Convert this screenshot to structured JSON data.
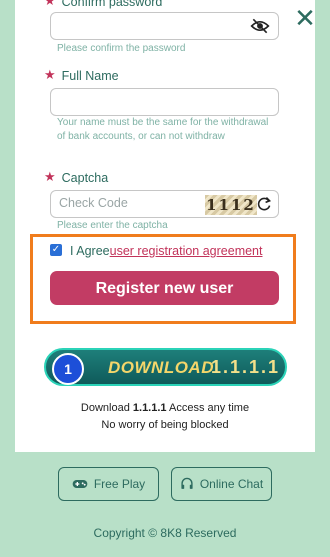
{
  "form": {
    "confirm_password": {
      "label": "Confirm password",
      "hint": "Please confirm the password"
    },
    "full_name": {
      "label": "Full Name",
      "hint": "Your name must be the same for the withdrawal of bank accounts, or can not withdraw"
    },
    "captcha": {
      "label": "Captcha",
      "placeholder": "Check Code",
      "code": "1112",
      "hint": "Please enter the captcha"
    },
    "agreement": {
      "prefix": "I Agree",
      "link": "user registration agreement",
      "checked": true
    },
    "register_label": "Register new user"
  },
  "download": {
    "label": "DOWNLOAD",
    "version": "1.1.1.1",
    "note_prefix": "Download",
    "note_suffix": "Access any time",
    "note2": "No worry of being blocked"
  },
  "footer": {
    "free_play": "Free Play",
    "online_chat": "Online Chat",
    "copyright": "Copyright © 8K8 Reserved"
  },
  "colors": {
    "accent": "#c23c64",
    "teal": "#2d6b5f",
    "highlight": "#f07c1c",
    "background": "#b8e0c8"
  }
}
